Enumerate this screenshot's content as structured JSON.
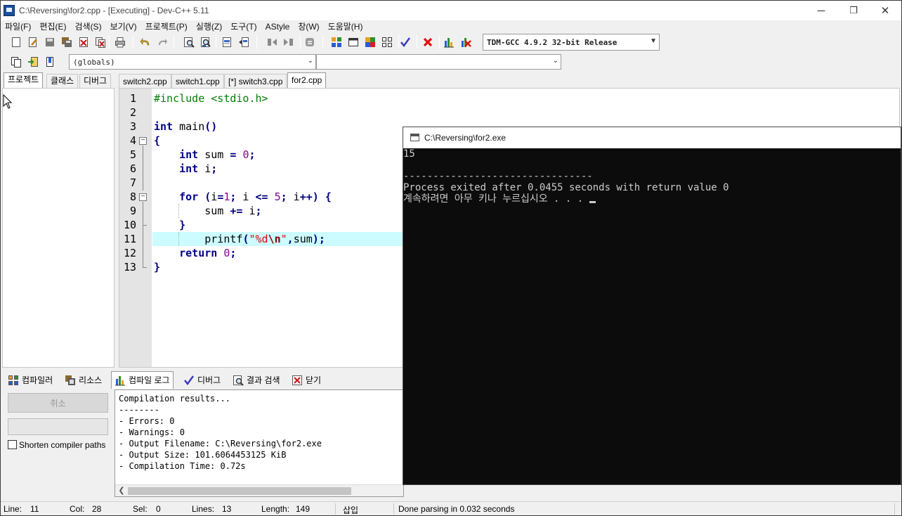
{
  "window": {
    "title": "C:\\Reversing\\for2.cpp - [Executing] - Dev-C++ 5.11",
    "minimize_glyph": "─",
    "restore_glyph": "❐",
    "close_glyph": "✕"
  },
  "menubar": {
    "items": [
      "파일(F)",
      "편집(E)",
      "검색(S)",
      "보기(V)",
      "프로젝트(P)",
      "실행(Z)",
      "도구(T)",
      "AStyle",
      "창(W)",
      "도움말(H)"
    ]
  },
  "toolbar": {
    "icons": [
      "new-file-icon",
      "open-file-icon",
      "save-icon",
      "save-all-icon",
      "close-file-icon",
      "close-all-icon",
      "print-icon",
      "undo-icon",
      "redo-icon",
      "find-icon",
      "replace-icon",
      "goto-line-icon",
      "goto-function-icon",
      "indent-icon",
      "unindent-icon",
      "toggle-comment-icon",
      "compile-icon",
      "run-icon",
      "compile-run-icon",
      "rebuild-icon",
      "syntax-check-icon",
      "stop-icon",
      "profile-icon",
      "delete-profile-icon"
    ],
    "compiler": "TDM-GCC 4.9.2 32-bit Release",
    "class_browser_icons": [
      "new-class-icon",
      "insert-icon",
      "toggle-bookmark-icon"
    ],
    "scope": "(globals)",
    "function": ""
  },
  "left_panel": {
    "tabs": [
      "프로젝트",
      "클래스",
      "디버그"
    ],
    "active_tab": "프로젝트"
  },
  "editor": {
    "tabs": [
      "switch2.cpp",
      "switch1.cpp",
      "[*] switch3.cpp",
      "for2.cpp"
    ],
    "active_tab": "for2.cpp",
    "line_numbers": [
      "1",
      "2",
      "3",
      "4",
      "5",
      "6",
      "7",
      "8",
      "9",
      "10",
      "11",
      "12",
      "13"
    ],
    "lines": [
      "#include <stdio.h>",
      "",
      "int main()",
      "{",
      "    int sum = 0;",
      "    int i;",
      "",
      "    for (i=1; i <= 5; i++) {",
      "        sum += i;",
      "    }",
      "        printf(\"%d\\n\",sum);",
      "    return 0;",
      "}"
    ],
    "highlighted_line": "11"
  },
  "bottom_panel": {
    "tabs": [
      "컴파일러",
      "리소스",
      "컴파일 로그",
      "디버그",
      "결과 검색",
      "닫기"
    ],
    "active_tab": "컴파일 로그",
    "cancel_label": "취소",
    "shorten_paths_label": "Shorten compiler paths",
    "shorten_paths_checked": false,
    "log_lines": [
      "Compilation results...",
      "--------",
      "- Errors: 0",
      "- Warnings: 0",
      "- Output Filename: C:\\Reversing\\for2.exe",
      "- Output Size: 101.6064453125 KiB",
      "- Compilation Time: 0.72s"
    ]
  },
  "statusbar": {
    "line_label": "Line:",
    "line_value": "11",
    "col_label": "Col:",
    "col_value": "28",
    "sel_label": "Sel:",
    "sel_value": "0",
    "lines_label": "Lines:",
    "lines_value": "13",
    "length_label": "Length:",
    "length_value": "149",
    "mode": "삽입",
    "message": "Done parsing in 0.032 seconds"
  },
  "console": {
    "title": "C:\\Reversing\\for2.exe",
    "lines": [
      "15",
      "",
      "--------------------------------",
      "Process exited after 0.0455 seconds with return value 0",
      "계속하려면 아무 키나 누르십시오 . . . "
    ]
  },
  "colors": {
    "highlight_line": "#ccfcff",
    "keyword": "#00008b",
    "preprocessor": "#008000",
    "number": "#8b008b",
    "string": "#e00000",
    "console_bg": "#0c0c0c",
    "console_fg": "#cccccc"
  }
}
